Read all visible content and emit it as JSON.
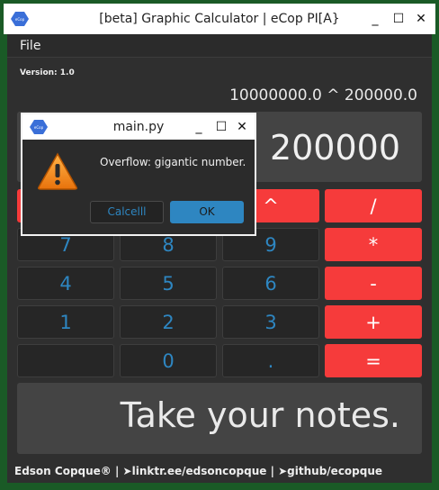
{
  "window": {
    "title": "[beta] Graphic Calculator | eCop PI[A}",
    "icon_label": "eCop PI[A}",
    "controls": {
      "minimize": "_",
      "maximize": "☐",
      "close": "✕"
    }
  },
  "menu": {
    "file": "File"
  },
  "version": "Version: 1.0",
  "expression": "10000000.0 ^ 200000.0",
  "display": "200000",
  "keypad": {
    "row1": [
      "^",
      "/"
    ],
    "row2": [
      "7",
      "8",
      "9",
      "*"
    ],
    "row3": [
      "4",
      "5",
      "6",
      "-"
    ],
    "row4": [
      "1",
      "2",
      "3",
      "+"
    ],
    "row5": [
      "",
      "0",
      ".",
      "="
    ]
  },
  "notes": "Take your notes.",
  "footer": "Edson Copque® | ➤linktr.ee/edsoncopque | ➤github/ecopque",
  "dialog": {
    "title": "main.py",
    "message": "Overflow: gigantic number.",
    "cancel": "Calcelll",
    "ok": "OK",
    "icon": "warning-icon"
  },
  "colors": {
    "accent_red": "#f63b3b",
    "accent_blue": "#2e86c1",
    "frame_green": "#1a5a26"
  }
}
